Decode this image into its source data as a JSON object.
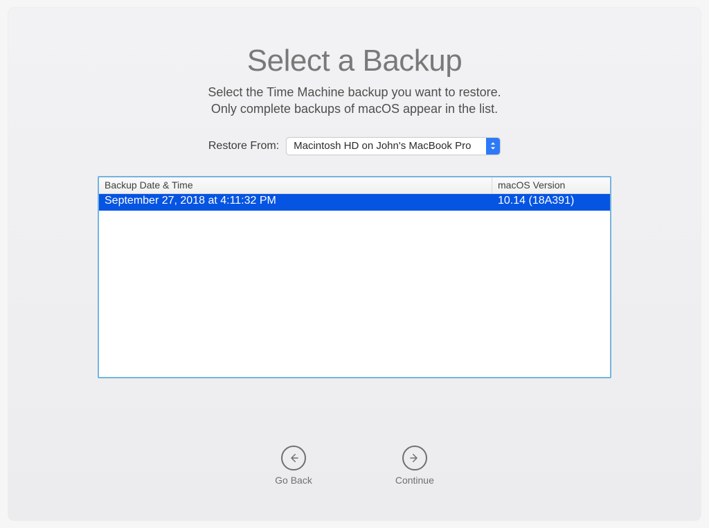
{
  "header": {
    "title": "Select a Backup",
    "subtitle_line1": "Select the Time Machine backup you want to restore.",
    "subtitle_line2": "Only complete backups of macOS appear in the list."
  },
  "restore": {
    "label": "Restore From:",
    "selected": "Macintosh HD on John's MacBook Pro"
  },
  "table": {
    "columns": {
      "date": "Backup Date & Time",
      "version": "macOS Version"
    },
    "rows": [
      {
        "date": "September 27, 2018 at 4:11:32 PM",
        "version": "10.14 (18A391)",
        "selected": true
      }
    ]
  },
  "footer": {
    "go_back": "Go Back",
    "continue": "Continue"
  }
}
